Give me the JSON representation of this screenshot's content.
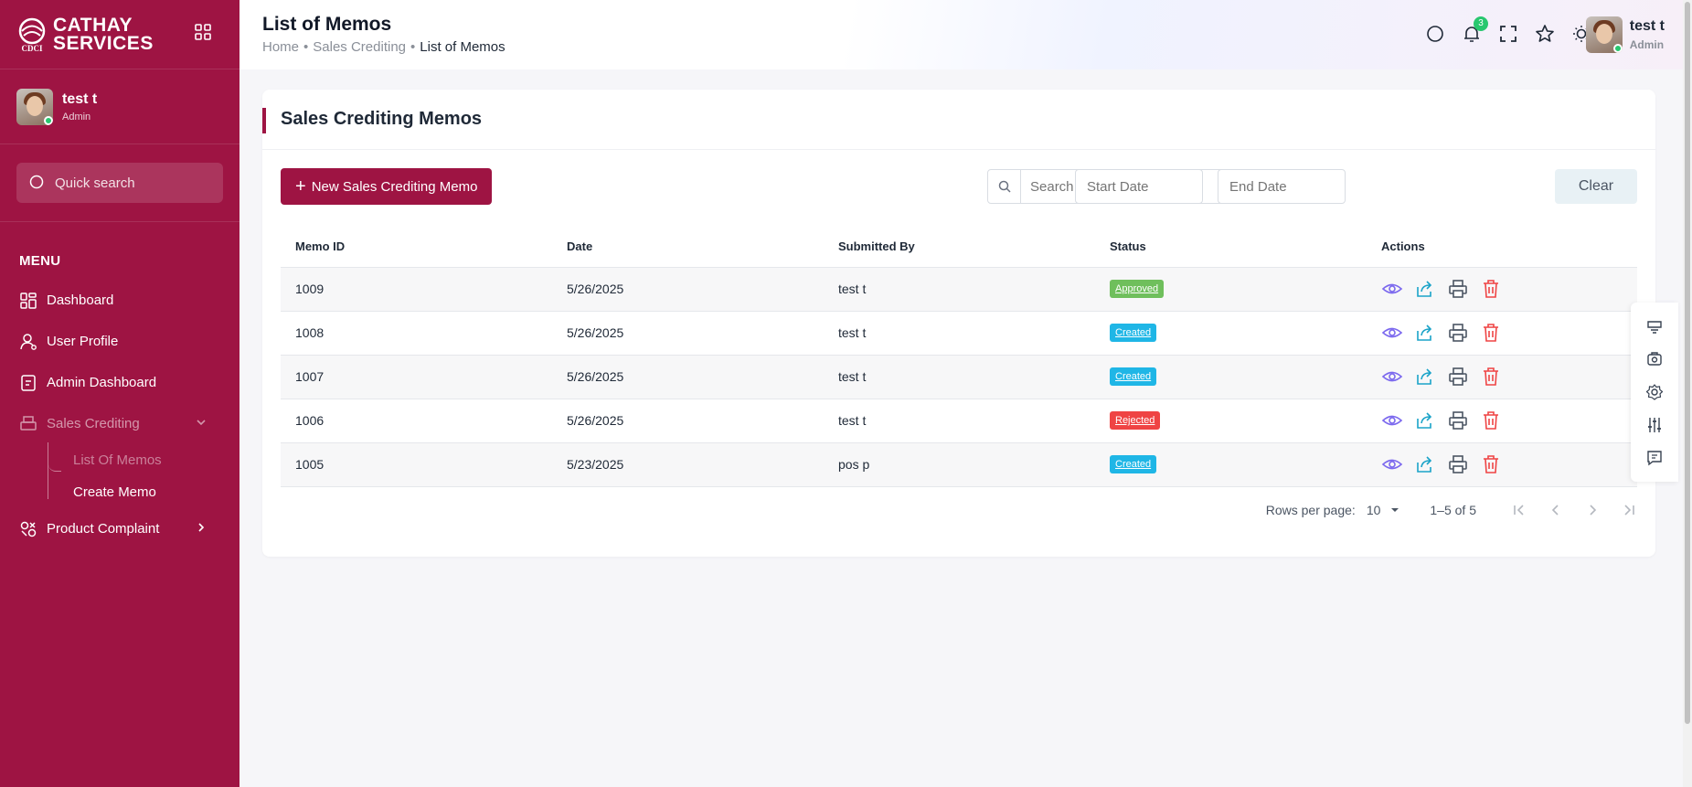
{
  "brand": {
    "line1": "CATHAY",
    "line2": "SERVICES",
    "logo_text": "CDCI"
  },
  "user": {
    "name": "test t",
    "role": "Admin"
  },
  "sidebar": {
    "search_placeholder": "Quick search",
    "menu_title": "MENU",
    "items": [
      {
        "label": "Dashboard",
        "icon": "dashboard-icon"
      },
      {
        "label": "User Profile",
        "icon": "user-icon"
      },
      {
        "label": "Admin Dashboard",
        "icon": "document-icon"
      },
      {
        "label": "Sales Crediting",
        "icon": "printer-icon"
      },
      {
        "label": "Product Complaint",
        "icon": "shapes-icon"
      }
    ],
    "sub_items": [
      "List Of Memos",
      "Create Memo"
    ]
  },
  "header": {
    "title": "List of Memos",
    "breadcrumb": [
      "Home",
      "Sales Crediting",
      "List of Memos"
    ],
    "notification_count": "3"
  },
  "card": {
    "title": "Sales Crediting Memos",
    "new_button": "New Sales Crediting Memo",
    "search_placeholder": "Search complaints...",
    "start_date_placeholder": "Start Date",
    "end_date_placeholder": "End Date",
    "clear_button": "Clear"
  },
  "table": {
    "columns": [
      "Memo ID",
      "Date",
      "Submitted By",
      "Status",
      "Actions"
    ],
    "rows": [
      {
        "id": "1009",
        "date": "5/26/2025",
        "by": "test t",
        "status": "Approved",
        "color": "#6fbf5c"
      },
      {
        "id": "1008",
        "date": "5/26/2025",
        "by": "test t",
        "status": "Created",
        "color": "#1fb6e6"
      },
      {
        "id": "1007",
        "date": "5/26/2025",
        "by": "test t",
        "status": "Created",
        "color": "#1fb6e6"
      },
      {
        "id": "1006",
        "date": "5/26/2025",
        "by": "test t",
        "status": "Rejected",
        "color": "#ef4444"
      },
      {
        "id": "1005",
        "date": "5/23/2025",
        "by": "pos p",
        "status": "Created",
        "color": "#1fb6e6"
      }
    ]
  },
  "pagination": {
    "rows_per_page_label": "Rows per page:",
    "rows_per_page": "10",
    "range": "1–5 of 5"
  },
  "colors": {
    "primary": "#9e1443",
    "approved": "#6fbf5c",
    "created": "#1fb6e6",
    "rejected": "#ef4444",
    "view": "#7b68ee",
    "share": "#1aa3c8",
    "delete": "#ef4444"
  }
}
